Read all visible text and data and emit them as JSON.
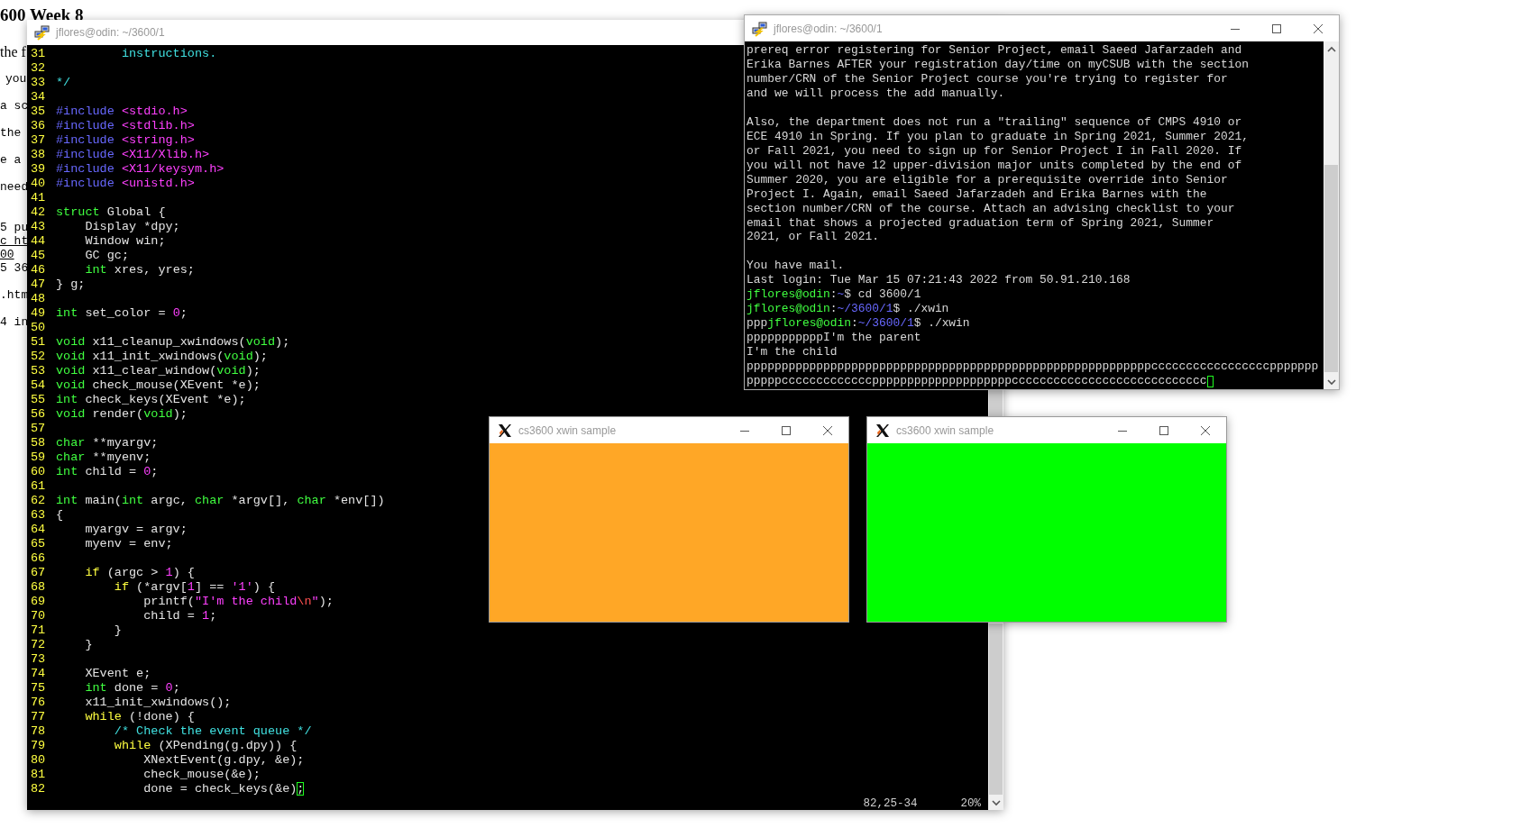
{
  "background_page": {
    "heading": "600 Week 8",
    "lines": [
      {
        "text": "the f",
        "kind": "prose"
      },
      {
        "text": "you",
        "kind": "mono"
      },
      {
        "text": "a sc",
        "kind": "mono"
      },
      {
        "text": "the",
        "kind": "mono"
      },
      {
        "text": "e a",
        "kind": "mono"
      },
      {
        "text": "need",
        "kind": "mono"
      },
      {
        "text": "5 pu",
        "kind": "mono"
      },
      {
        "text": "c_ht",
        "kind": "link"
      },
      {
        "text": "00",
        "kind": "link"
      },
      {
        "text": "5 36",
        "kind": "mono"
      },
      {
        "text": ".htm",
        "kind": "mono"
      },
      {
        "text": "4 in",
        "kind": "mono"
      }
    ]
  },
  "windows": [
    {
      "kind": "editor",
      "title": "jflores@odin: ~/3600/1",
      "lines": [
        {
          "number": "31",
          "tokens": [
            {
              "text": "         instructions.",
              "kind": "comment"
            }
          ]
        },
        {
          "number": "32"
        },
        {
          "number": "33",
          "tokens": [
            {
              "text": "*/",
              "kind": "comment"
            }
          ]
        },
        {
          "number": "34"
        },
        {
          "number": "35",
          "tokens": [
            {
              "text": "#include",
              "kind": "preproc"
            },
            {
              "text": " <stdio.h>",
              "kind": "header"
            }
          ]
        },
        {
          "number": "36",
          "tokens": [
            {
              "text": "#include",
              "kind": "preproc"
            },
            {
              "text": " <stdlib.h>",
              "kind": "header"
            }
          ]
        },
        {
          "number": "37",
          "tokens": [
            {
              "text": "#include",
              "kind": "preproc"
            },
            {
              "text": " <string.h>",
              "kind": "header"
            }
          ]
        },
        {
          "number": "38",
          "tokens": [
            {
              "text": "#include",
              "kind": "preproc"
            },
            {
              "text": " <X11/Xlib.h>",
              "kind": "header"
            }
          ]
        },
        {
          "number": "39",
          "tokens": [
            {
              "text": "#include",
              "kind": "preproc"
            },
            {
              "text": " <X11/keysym.h>",
              "kind": "header"
            }
          ]
        },
        {
          "number": "40",
          "tokens": [
            {
              "text": "#include",
              "kind": "preproc"
            },
            {
              "text": " <unistd.h>",
              "kind": "header"
            }
          ]
        },
        {
          "number": "41"
        },
        {
          "number": "42",
          "tokens": [
            {
              "text": "struct",
              "kind": "type"
            },
            {
              "text": " Global {",
              "kind": "plain"
            }
          ]
        },
        {
          "number": "43",
          "tokens": [
            {
              "text": "    Display *dpy;",
              "kind": "plain"
            }
          ]
        },
        {
          "number": "44",
          "tokens": [
            {
              "text": "    Window win;",
              "kind": "plain"
            }
          ]
        },
        {
          "number": "45",
          "tokens": [
            {
              "text": "    GC gc;",
              "kind": "plain"
            }
          ]
        },
        {
          "number": "46",
          "tokens": [
            {
              "text": "    int",
              "kind": "type"
            },
            {
              "text": " xres, yres;",
              "kind": "plain"
            }
          ]
        },
        {
          "number": "47",
          "tokens": [
            {
              "text": "} g;",
              "kind": "plain"
            }
          ]
        },
        {
          "number": "48"
        },
        {
          "number": "49",
          "tokens": [
            {
              "text": "int",
              "kind": "type"
            },
            {
              "text": " set_color = ",
              "kind": "plain"
            },
            {
              "text": "0",
              "kind": "number"
            },
            {
              "text": ";",
              "kind": "plain"
            }
          ]
        },
        {
          "number": "50"
        },
        {
          "number": "51",
          "tokens": [
            {
              "text": "void",
              "kind": "type"
            },
            {
              "text": " x11_cleanup_xwindows(",
              "kind": "plain"
            },
            {
              "text": "void",
              "kind": "type"
            },
            {
              "text": ");",
              "kind": "plain"
            }
          ]
        },
        {
          "number": "52",
          "tokens": [
            {
              "text": "void",
              "kind": "type"
            },
            {
              "text": " x11_init_xwindows(",
              "kind": "plain"
            },
            {
              "text": "void",
              "kind": "type"
            },
            {
              "text": ");",
              "kind": "plain"
            }
          ]
        },
        {
          "number": "53",
          "tokens": [
            {
              "text": "void",
              "kind": "type"
            },
            {
              "text": " x11_clear_window(",
              "kind": "plain"
            },
            {
              "text": "void",
              "kind": "type"
            },
            {
              "text": ");",
              "kind": "plain"
            }
          ]
        },
        {
          "number": "54",
          "tokens": [
            {
              "text": "void",
              "kind": "type"
            },
            {
              "text": " check_mouse(XEvent *e);",
              "kind": "plain"
            }
          ]
        },
        {
          "number": "55",
          "tokens": [
            {
              "text": "int",
              "kind": "type"
            },
            {
              "text": " check_keys(XEvent *e);",
              "kind": "plain"
            }
          ]
        },
        {
          "number": "56",
          "tokens": [
            {
              "text": "void",
              "kind": "type"
            },
            {
              "text": " render(",
              "kind": "plain"
            },
            {
              "text": "void",
              "kind": "type"
            },
            {
              "text": ");",
              "kind": "plain"
            }
          ]
        },
        {
          "number": "57"
        },
        {
          "number": "58",
          "tokens": [
            {
              "text": "char",
              "kind": "type"
            },
            {
              "text": " **myargv;",
              "kind": "plain"
            }
          ]
        },
        {
          "number": "59",
          "tokens": [
            {
              "text": "char",
              "kind": "type"
            },
            {
              "text": " **myenv;",
              "kind": "plain"
            }
          ]
        },
        {
          "number": "60",
          "tokens": [
            {
              "text": "int",
              "kind": "type"
            },
            {
              "text": " child = ",
              "kind": "plain"
            },
            {
              "text": "0",
              "kind": "number"
            },
            {
              "text": ";",
              "kind": "plain"
            }
          ]
        },
        {
          "number": "61"
        },
        {
          "number": "62",
          "tokens": [
            {
              "text": "int",
              "kind": "type"
            },
            {
              "text": " main(",
              "kind": "plain"
            },
            {
              "text": "int",
              "kind": "type"
            },
            {
              "text": " argc, ",
              "kind": "plain"
            },
            {
              "text": "char",
              "kind": "type"
            },
            {
              "text": " *argv[], ",
              "kind": "plain"
            },
            {
              "text": "char",
              "kind": "type"
            },
            {
              "text": " *env[])",
              "kind": "plain"
            }
          ]
        },
        {
          "number": "63",
          "tokens": [
            {
              "text": "{",
              "kind": "plain"
            }
          ]
        },
        {
          "number": "64",
          "tokens": [
            {
              "text": "    myargv = argv;",
              "kind": "plain"
            }
          ]
        },
        {
          "number": "65",
          "tokens": [
            {
              "text": "    myenv = env;",
              "kind": "plain"
            }
          ]
        },
        {
          "number": "66"
        },
        {
          "number": "67",
          "tokens": [
            {
              "text": "    if",
              "kind": "keyword"
            },
            {
              "text": " (argc > ",
              "kind": "plain"
            },
            {
              "text": "1",
              "kind": "number"
            },
            {
              "text": ") {",
              "kind": "plain"
            }
          ]
        },
        {
          "number": "68",
          "tokens": [
            {
              "text": "        if",
              "kind": "keyword"
            },
            {
              "text": " (*argv[",
              "kind": "plain"
            },
            {
              "text": "1",
              "kind": "number"
            },
            {
              "text": "] == ",
              "kind": "plain"
            },
            {
              "text": "'1'",
              "kind": "string"
            },
            {
              "text": ") {",
              "kind": "plain"
            }
          ]
        },
        {
          "number": "69",
          "tokens": [
            {
              "text": "            printf(",
              "kind": "plain"
            },
            {
              "text": "\"I'm the child",
              "kind": "string"
            },
            {
              "text": "\\n",
              "kind": "special"
            },
            {
              "text": "\"",
              "kind": "string"
            },
            {
              "text": ");",
              "kind": "plain"
            }
          ]
        },
        {
          "number": "70",
          "tokens": [
            {
              "text": "            child = ",
              "kind": "plain"
            },
            {
              "text": "1",
              "kind": "number"
            },
            {
              "text": ";",
              "kind": "plain"
            }
          ]
        },
        {
          "number": "71",
          "tokens": [
            {
              "text": "        }",
              "kind": "plain"
            }
          ]
        },
        {
          "number": "72",
          "tokens": [
            {
              "text": "    }",
              "kind": "plain"
            }
          ]
        },
        {
          "number": "73"
        },
        {
          "number": "74",
          "tokens": [
            {
              "text": "    XEvent e;",
              "kind": "plain"
            }
          ]
        },
        {
          "number": "75",
          "tokens": [
            {
              "text": "    int",
              "kind": "type"
            },
            {
              "text": " done = ",
              "kind": "plain"
            },
            {
              "text": "0",
              "kind": "number"
            },
            {
              "text": ";",
              "kind": "plain"
            }
          ]
        },
        {
          "number": "76",
          "tokens": [
            {
              "text": "    x11_init_xwindows();",
              "kind": "plain"
            }
          ]
        },
        {
          "number": "77",
          "tokens": [
            {
              "text": "    while",
              "kind": "keyword"
            },
            {
              "text": " (!done) {",
              "kind": "plain"
            }
          ]
        },
        {
          "number": "78",
          "tokens": [
            {
              "text": "        /* Check the event queue */",
              "kind": "comment"
            }
          ]
        },
        {
          "number": "79",
          "tokens": [
            {
              "text": "        while",
              "kind": "keyword"
            },
            {
              "text": " (XPending(g.dpy)) {",
              "kind": "plain"
            }
          ]
        },
        {
          "number": "80",
          "tokens": [
            {
              "text": "            XNextEvent(g.dpy, &e);",
              "kind": "plain"
            }
          ]
        },
        {
          "number": "81",
          "tokens": [
            {
              "text": "            check_mouse(&e);",
              "kind": "plain"
            }
          ]
        },
        {
          "number": "82",
          "tokens": [
            {
              "text": "            done = check_keys(&e)",
              "kind": "plain"
            },
            {
              "text": ";",
              "kind": "cursor"
            }
          ]
        }
      ],
      "status": {
        "position": "82,25-34",
        "percent": "20%"
      }
    },
    {
      "kind": "terminal",
      "title": "jflores@odin: ~/3600/1",
      "cursor_at_end": true,
      "lines": [
        {
          "tokens": [
            {
              "text": "prereq error registering for Senior Project, email Saeed Jafarzadeh and",
              "kind": "plain"
            }
          ]
        },
        {
          "tokens": [
            {
              "text": "Erika Barnes AFTER your registration day/time on myCSUB with the section",
              "kind": "plain"
            }
          ]
        },
        {
          "tokens": [
            {
              "text": "number/CRN of the Senior Project course you're trying to register for",
              "kind": "plain"
            }
          ]
        },
        {
          "tokens": [
            {
              "text": "and we will process the add manually.",
              "kind": "plain"
            }
          ]
        },
        {
          "kind": "blank"
        },
        {
          "tokens": [
            {
              "text": "Also, the department does not run a \"trailing\" sequence of CMPS 4910 or",
              "kind": "plain"
            }
          ]
        },
        {
          "tokens": [
            {
              "text": "ECE 4910 in Spring. If you plan to graduate in Spring 2021, Summer 2021,",
              "kind": "plain"
            }
          ]
        },
        {
          "tokens": [
            {
              "text": "or Fall 2021, you need to sign up for Senior Project I in Fall 2020. If",
              "kind": "plain"
            }
          ]
        },
        {
          "tokens": [
            {
              "text": "you will not have 12 upper-division major units completed by the end of",
              "kind": "plain"
            }
          ]
        },
        {
          "tokens": [
            {
              "text": "Summer 2020, you are eligible for a prerequisite override into Senior",
              "kind": "plain"
            }
          ]
        },
        {
          "tokens": [
            {
              "text": "Project I. Again, email Saeed Jafarzadeh and Erika Barnes with the",
              "kind": "plain"
            }
          ]
        },
        {
          "tokens": [
            {
              "text": "section number/CRN of the course. Attach an advising checklist to your",
              "kind": "plain"
            }
          ]
        },
        {
          "tokens": [
            {
              "text": "email that shows a projected graduation term of Spring 2021, Summer",
              "kind": "plain"
            }
          ]
        },
        {
          "tokens": [
            {
              "text": "2021, or Fall 2021.",
              "kind": "plain"
            }
          ]
        },
        {
          "kind": "blank"
        },
        {
          "tokens": [
            {
              "text": "You have mail.",
              "kind": "plain"
            }
          ]
        },
        {
          "tokens": [
            {
              "text": "Last login: Tue Mar 15 07:21:43 2022 from 50.91.210.168",
              "kind": "plain"
            }
          ]
        },
        {
          "tokens": [
            {
              "text": "jflores@odin",
              "kind": "user"
            },
            {
              "text": ":",
              "kind": "plain"
            },
            {
              "text": "~",
              "kind": "path"
            },
            {
              "text": "$ cd 3600/1",
              "kind": "plain"
            }
          ]
        },
        {
          "tokens": [
            {
              "text": "jflores@odin",
              "kind": "user"
            },
            {
              "text": ":",
              "kind": "plain"
            },
            {
              "text": "~/3600/1",
              "kind": "path"
            },
            {
              "text": "$ ./xwin",
              "kind": "plain"
            }
          ]
        },
        {
          "tokens": [
            {
              "text": "ppp",
              "kind": "plain"
            },
            {
              "text": "jflores@odin",
              "kind": "user"
            },
            {
              "text": ":",
              "kind": "plain"
            },
            {
              "text": "~/3600/1",
              "kind": "path"
            },
            {
              "text": "$ ./xwin",
              "kind": "plain"
            }
          ]
        },
        {
          "tokens": [
            {
              "text": "pppppppppppI'm the parent",
              "kind": "plain"
            }
          ]
        },
        {
          "tokens": [
            {
              "text": "I'm the child",
              "kind": "plain"
            }
          ]
        },
        {
          "tokens": [
            {
              "text": "ppppppppppppppppppppppppppppppppppppppppppppppppppppppppppcccccccccccccccccppppppp",
              "kind": "plain"
            }
          ]
        },
        {
          "tokens": [
            {
              "text": "pppppcccccccccccccppppppppppppppppppppcccccccccccccccccccccccccccc",
              "kind": "plain"
            }
          ]
        }
      ]
    },
    {
      "kind": "xwin",
      "title": "cs3600 xwin sample",
      "color": "#ffa726"
    },
    {
      "kind": "xwin",
      "title": "cs3600 xwin sample",
      "color": "#00ff00"
    }
  ]
}
